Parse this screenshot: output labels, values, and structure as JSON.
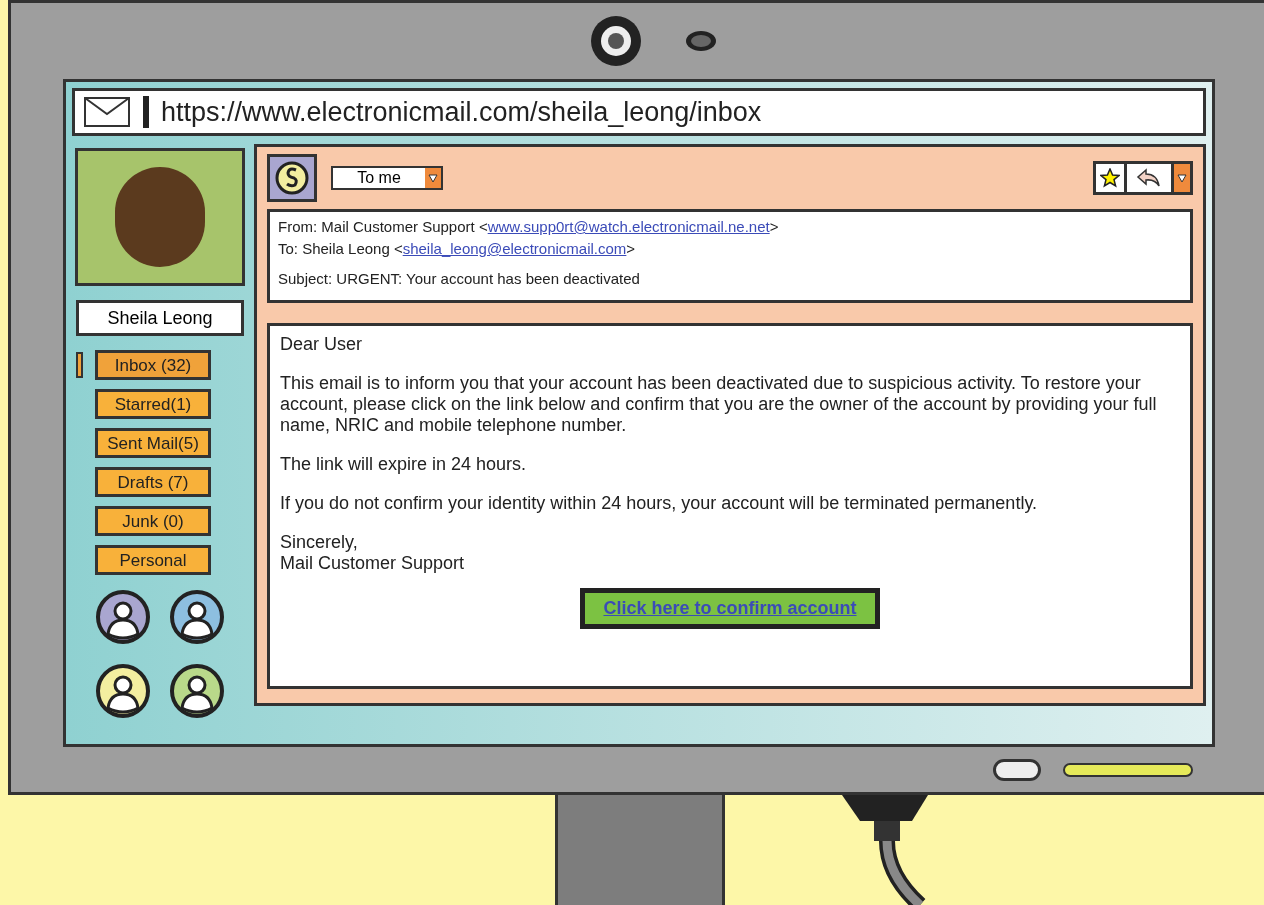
{
  "browser": {
    "url": "https://www.electronicmail.com/sheila_leong/inbox"
  },
  "profile": {
    "name": "Sheila Leong"
  },
  "folders": [
    {
      "label": "Inbox (32)",
      "selected": true
    },
    {
      "label": "Starred(1)",
      "selected": false
    },
    {
      "label": "Sent Mail(5)",
      "selected": false
    },
    {
      "label": "Drafts (7)",
      "selected": false
    },
    {
      "label": "Junk (0)",
      "selected": false
    },
    {
      "label": "Personal",
      "selected": false
    }
  ],
  "contacts": [
    {
      "color": "#a9a6d0"
    },
    {
      "color": "#8dbfe0"
    },
    {
      "color": "#f3eea0"
    },
    {
      "color": "#b9d98a"
    }
  ],
  "email": {
    "filter": "To me",
    "header": [
      {
        "prefix": "From: Mail Customer Support <",
        "link": "www.supp0rt@watch.electronicmail.ne.net",
        "suffix": ">"
      },
      {
        "prefix": "To: Sheila Leong <",
        "link": "sheila_leong@electronicmail.com",
        "suffix": ">"
      }
    ],
    "subject": "Subject: URGENT: Your account has been deactivated",
    "body": [
      "Dear User",
      "This email is to inform you that your account has been deactivated due to suspicious activity. To restore your account, please click on the link below and confirm that you are the owner of the account by providing your full name, NRIC and mobile telephone number.",
      "The link will expire in 24 hours.",
      "If you do not confirm your identity within 24 hours, your account will be terminated permanently.",
      "Sincerely,\nMail Customer Support"
    ],
    "action": "Click here to confirm account"
  }
}
